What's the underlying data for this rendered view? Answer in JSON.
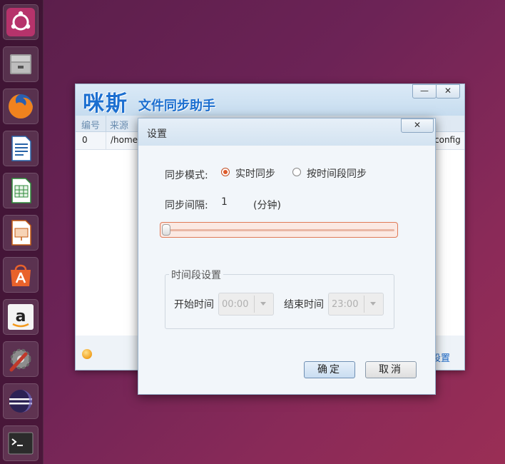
{
  "launcher": {
    "items": [
      "ubuntu-dash-icon",
      "files-icon",
      "firefox-icon",
      "writer-icon",
      "calc-icon",
      "impress-icon",
      "software-center-icon",
      "amazon-icon",
      "system-settings-icon",
      "eclipse-icon",
      "terminal-icon"
    ]
  },
  "main_window": {
    "title_big": "咪斯",
    "title_small": "文件同步助手",
    "minimize": "—",
    "close": "✕",
    "columns": [
      "编号",
      "来源"
    ],
    "row": {
      "id": "0",
      "source": "/home/",
      "target_tail": "config"
    },
    "settings_link": "设置"
  },
  "dialog": {
    "title": "设置",
    "close": "✕",
    "sync_mode_label": "同步模式:",
    "mode_realtime": "实时同步",
    "mode_period": "按时间段同步",
    "selected_mode": "realtime",
    "interval_label": "同步间隔:",
    "interval_value": "1",
    "interval_unit": "(分钟)",
    "group_title": "时间段设置",
    "start_label": "开始时间",
    "start_value": "00:00",
    "end_label": "结束时间",
    "end_value": "23:00",
    "ok": "确定",
    "cancel": "取消"
  }
}
